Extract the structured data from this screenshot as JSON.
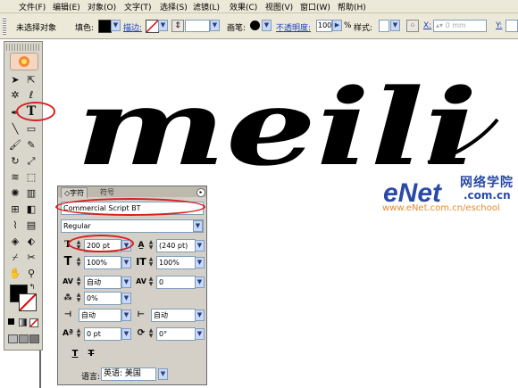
{
  "menu": {
    "items": [
      "文件(F)",
      "编辑(E)",
      "对象(O)",
      "文字(T)",
      "选择(S)",
      "滤镜(L)",
      "效果(C)",
      "视图(V)",
      "窗口(W)",
      "帮助(H)"
    ]
  },
  "control_bar": {
    "status": "未选择对象",
    "fill_label": "填色:",
    "stroke_label": "描边:",
    "brush_label": "画笔:",
    "opacity_label": "不透明度:",
    "opacity_value": "100",
    "percent_sign": "%",
    "style_label": "样式:",
    "x_label": "X:",
    "x_value": "0 mm",
    "y_label": "Y:"
  },
  "canvas": {
    "art_text": "meili"
  },
  "watermark": {
    "logo": "eNet",
    "logo_suffix": "网络学院",
    "domain_suffix": ".com.cn",
    "url": "www.eNet.com.cn/eschool"
  },
  "char_panel": {
    "tabs": [
      "◇字符",
      "符号"
    ],
    "font_family": "Commercial Script BT",
    "font_style": "Regular",
    "font_size": "200 pt",
    "leading": "(240 pt)",
    "vertical_scale": "100%",
    "horizontal_scale": "100%",
    "kerning": "自动",
    "tracking": "0",
    "tsume": "0%",
    "aki_left": "自动",
    "aki_right": "自动",
    "baseline_shift": "0 pt",
    "rotation": "0°",
    "language_label": "语言:",
    "language": "英语: 美国"
  },
  "colors": {
    "chrome": "#ece9d8",
    "link": "#1a3fbf",
    "annotation": "#d81f1f",
    "watermark_blue": "#2a4aa8",
    "watermark_orange": "#e8892a"
  }
}
